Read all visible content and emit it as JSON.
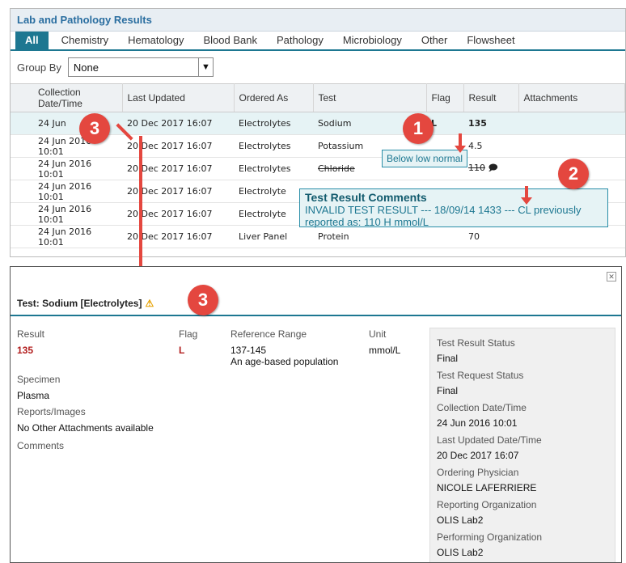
{
  "panel": {
    "title": "Lab and Pathology Results"
  },
  "tabs": [
    "All",
    "Chemistry",
    "Hematology",
    "Blood Bank",
    "Pathology",
    "Microbiology",
    "Other",
    "Flowsheet"
  ],
  "groupby": {
    "label": "Group By",
    "value": "None"
  },
  "table": {
    "headers": [
      "Collection Date/Time",
      "Last Updated",
      "Ordered As",
      "Test",
      "Flag",
      "Result",
      "Attachments"
    ],
    "rows": [
      [
        "24 Jun",
        "20 Dec 2017 16:07",
        "Electrolytes",
        "Sodium",
        "L",
        "135",
        ""
      ],
      [
        "24 Jun 2016 10:01",
        "20 Dec 2017 16:07",
        "Electrolytes",
        "Potassium",
        "",
        "4.5",
        ""
      ],
      [
        "24 Jun 2016 10:01",
        "20 Dec 2017 16:07",
        "Electrolytes",
        "Chloride",
        "",
        "110",
        ""
      ],
      [
        "24 Jun 2016 10:01",
        "20 Dec 2017 16:07",
        "Electrolyte",
        "",
        "",
        "",
        ""
      ],
      [
        "24 Jun 2016 10:01",
        "20 Dec 2017 16:07",
        "Electrolyte",
        "",
        "",
        "",
        ""
      ],
      [
        "24 Jun 2016 10:01",
        "20 Dec 2017 16:07",
        "Liver Panel",
        "Protein",
        "",
        "70",
        ""
      ]
    ]
  },
  "tooltips": {
    "flag": "Below low normal",
    "comments_title": "Test Result Comments",
    "comments_text": "INVALID TEST RESULT --- 18/09/14 1433 --- CL previously reported as: 110 H mmol/L"
  },
  "callouts": [
    "1",
    "2",
    "3",
    "3"
  ],
  "detail": {
    "title": "Test: Sodium [Electrolytes]",
    "result_label": "Result",
    "result_value": "135",
    "flag_label": "Flag",
    "flag_value": "L",
    "ref_label": "Reference Range",
    "ref_value": "137-145",
    "ref_note": "An age-based population",
    "unit_label": "Unit",
    "unit_value": "mmol/L",
    "specimen_label": "Specimen",
    "specimen_value": "Plasma",
    "reports_label": "Reports/Images",
    "reports_value": "No Other Attachments available",
    "comments_label": "Comments",
    "side": [
      {
        "k": "Test Result Status",
        "v": "Final"
      },
      {
        "k": "Test Request Status",
        "v": "Final"
      },
      {
        "k": "Collection Date/Time",
        "v": "24 Jun 2016 10:01"
      },
      {
        "k": "Last Updated Date/Time",
        "v": "20 Dec 2017 16:07"
      },
      {
        "k": "Ordering Physician",
        "v": "NICOLE LAFERRIERE"
      },
      {
        "k": "Reporting Organization",
        "v": "OLIS Lab2"
      },
      {
        "k": "Performing Organization",
        "v": "OLIS Lab2"
      }
    ]
  },
  "colors": {
    "teal": "#1d7791",
    "flag_red": "#b21d1d",
    "callout": "#e4473f"
  }
}
